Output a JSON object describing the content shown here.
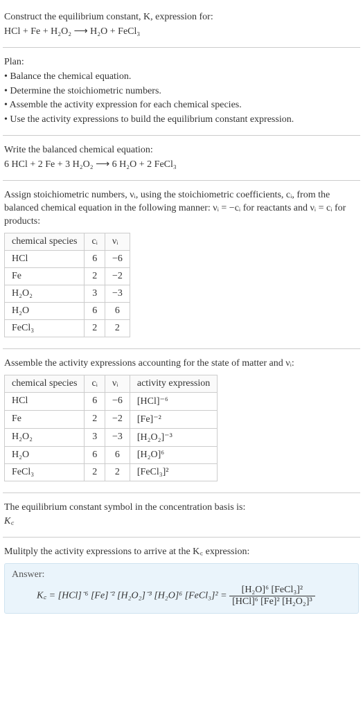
{
  "intro": {
    "line1": "Construct the equilibrium constant, K, expression for:",
    "equation_lhs": "HCl + Fe + H",
    "equation": "HCl + Fe + H₂O₂  ⟶  H₂O + FeCl₃"
  },
  "plan": {
    "heading": "Plan:",
    "items": [
      "• Balance the chemical equation.",
      "• Determine the stoichiometric numbers.",
      "• Assemble the activity expression for each chemical species.",
      "• Use the activity expressions to build the equilibrium constant expression."
    ]
  },
  "balanced": {
    "heading": "Write the balanced chemical equation:",
    "equation": "6 HCl + 2 Fe + 3 H₂O₂  ⟶  6 H₂O + 2 FeCl₃"
  },
  "stoich": {
    "text_a": "Assign stoichiometric numbers, νᵢ, using the stoichiometric coefficients, cᵢ, from the balanced chemical equation in the following manner: νᵢ = −cᵢ for reactants and νᵢ = cᵢ for products:",
    "headers": [
      "chemical species",
      "cᵢ",
      "νᵢ"
    ],
    "rows": [
      {
        "species": "HCl",
        "c": "6",
        "v": "−6"
      },
      {
        "species": "Fe",
        "c": "2",
        "v": "−2"
      },
      {
        "species": "H₂O₂",
        "c": "3",
        "v": "−3"
      },
      {
        "species": "H₂O",
        "c": "6",
        "v": "6"
      },
      {
        "species": "FeCl₃",
        "c": "2",
        "v": "2"
      }
    ]
  },
  "activity": {
    "heading": "Assemble the activity expressions accounting for the state of matter and νᵢ:",
    "headers": [
      "chemical species",
      "cᵢ",
      "νᵢ",
      "activity expression"
    ],
    "rows": [
      {
        "species": "HCl",
        "c": "6",
        "v": "−6",
        "expr": "[HCl]⁻⁶"
      },
      {
        "species": "Fe",
        "c": "2",
        "v": "−2",
        "expr": "[Fe]⁻²"
      },
      {
        "species": "H₂O₂",
        "c": "3",
        "v": "−3",
        "expr": "[H₂O₂]⁻³"
      },
      {
        "species": "H₂O",
        "c": "6",
        "v": "6",
        "expr": "[H₂O]⁶"
      },
      {
        "species": "FeCl₃",
        "c": "2",
        "v": "2",
        "expr": "[FeCl₃]²"
      }
    ]
  },
  "kc_symbol": {
    "heading": "The equilibrium constant symbol in the concentration basis is:",
    "symbol": "K꜀"
  },
  "final": {
    "heading": "Mulitply the activity expressions to arrive at the K꜀ expression:",
    "answer_label": "Answer:",
    "lhs": "K꜀ = [HCl]⁻⁶ [Fe]⁻² [H₂O₂]⁻³ [H₂O]⁶ [FeCl₃]² =",
    "frac_num": "[H₂O]⁶ [FeCl₃]²",
    "frac_den": "[HCl]⁶ [Fe]² [H₂O₂]³"
  },
  "chart_data": {
    "type": "table",
    "tables": [
      {
        "title": "stoichiometric numbers",
        "columns": [
          "chemical species",
          "c_i",
          "nu_i"
        ],
        "rows": [
          [
            "HCl",
            6,
            -6
          ],
          [
            "Fe",
            2,
            -2
          ],
          [
            "H2O2",
            3,
            -3
          ],
          [
            "H2O",
            6,
            6
          ],
          [
            "FeCl3",
            2,
            2
          ]
        ]
      },
      {
        "title": "activity expressions",
        "columns": [
          "chemical species",
          "c_i",
          "nu_i",
          "activity expression"
        ],
        "rows": [
          [
            "HCl",
            6,
            -6,
            "[HCl]^-6"
          ],
          [
            "Fe",
            2,
            -2,
            "[Fe]^-2"
          ],
          [
            "H2O2",
            3,
            -3,
            "[H2O2]^-3"
          ],
          [
            "H2O",
            6,
            6,
            "[H2O]^6"
          ],
          [
            "FeCl3",
            2,
            2,
            "[FeCl3]^2"
          ]
        ]
      }
    ]
  }
}
